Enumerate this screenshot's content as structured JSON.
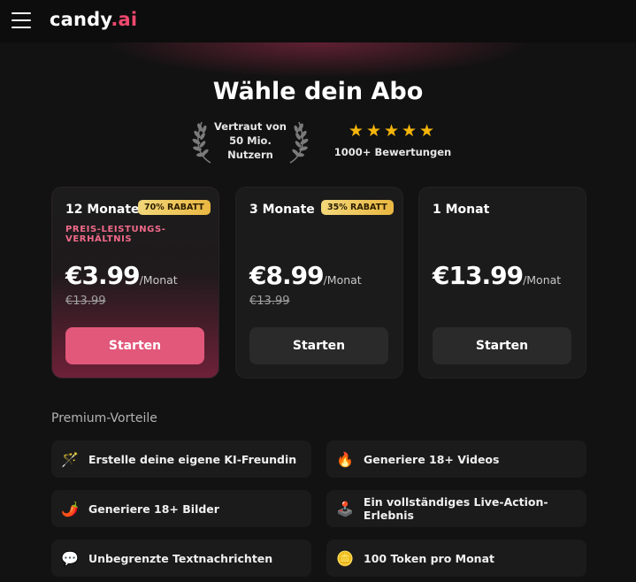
{
  "header": {
    "logo_main": "candy",
    "logo_accent": ".ai"
  },
  "hero": {
    "title": "Wähle dein Abo",
    "trust_line1": "Vertraut von",
    "trust_line2": "50 Mio.",
    "trust_line3": "Nutzern",
    "stars": "★★★★★",
    "rating_stars": 5,
    "reviews": "1000+ Bewertungen"
  },
  "plans": [
    {
      "name": "12 Monate",
      "badge": "70% RABATT",
      "note": "PREIS-LEISTUNGS-VERHÄLTNIS",
      "price": "€3.99",
      "per": "/Monat",
      "old_price": "€13.99",
      "cta": "Starten"
    },
    {
      "name": "3 Monate",
      "badge": "35% RABATT",
      "price": "€8.99",
      "per": "/Monat",
      "old_price": "€13.99",
      "cta": "Starten"
    },
    {
      "name": "1 Monat",
      "price": "€13.99",
      "per": "/Monat",
      "cta": "Starten"
    }
  ],
  "benefits": {
    "title": "Premium-Vorteile",
    "items": [
      {
        "icon": "🪄",
        "icon_name": "magic-wand-icon",
        "label": "Erstelle deine eigene KI-Freundin"
      },
      {
        "icon": "🔥",
        "icon_name": "fire-icon",
        "label": "Generiere 18+ Videos"
      },
      {
        "icon": "🌶️",
        "icon_name": "chili-icon",
        "label": "Generiere 18+ Bilder"
      },
      {
        "icon": "🕹️",
        "icon_name": "joystick-icon",
        "label": "Ein vollständiges Live-Action-Erlebnis"
      },
      {
        "icon": "💬",
        "icon_name": "chat-bubbles-icon",
        "label": "Unbegrenzte Textnachrichten"
      },
      {
        "icon": "🪙",
        "icon_name": "coin-icon",
        "label": "100 Token pro Monat"
      }
    ]
  },
  "colors": {
    "accent": "#e2587a",
    "star": "#f5b50a",
    "badge": "#e9b742",
    "background": "#121212"
  }
}
